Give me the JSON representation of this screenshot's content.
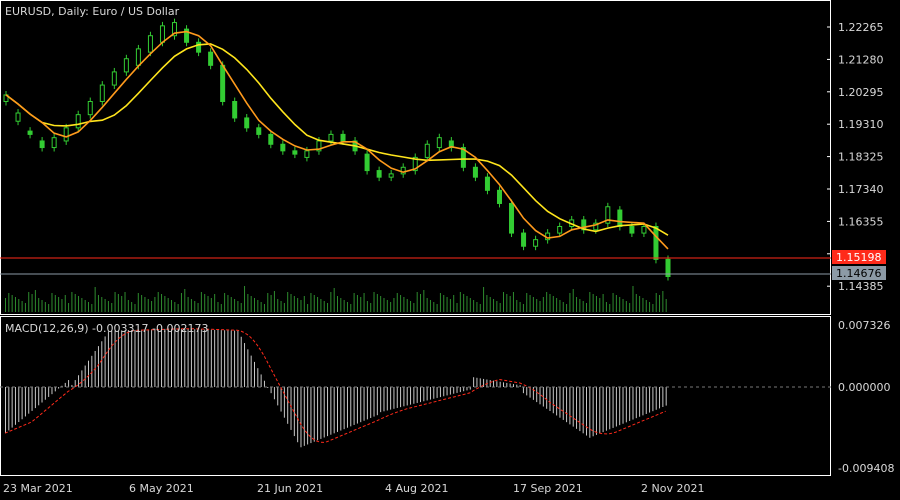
{
  "window": {
    "symbol_label": "EURUSD, Daily:  Euro / US Dollar",
    "background": "#000000",
    "grid_color": "#ffffff"
  },
  "price_axis": {
    "ticks": [
      "1.22265",
      "1.21280",
      "1.20295",
      "1.19310",
      "1.18325",
      "1.17340",
      "1.16355",
      "1.15370",
      "1.14385"
    ],
    "range": [
      1.1415,
      1.2285
    ]
  },
  "time_axis": {
    "ticks": [
      "23 Mar 2021",
      "6 May 2021",
      "21 Jun 2021",
      "4 Aug 2021",
      "17 Sep 2021",
      "2 Nov 2021"
    ]
  },
  "price_lines": {
    "alert": {
      "label": "1.15198",
      "color": "#ff2a1a"
    },
    "bid": {
      "label": "1.14676",
      "color": "#8c9aa6"
    }
  },
  "indicators": {
    "ma_fast_color": "#ff9a1c",
    "ma_slow_color": "#ffe51c",
    "candle_color": "#33cc33",
    "volume_color": "#2e8b2e"
  },
  "macd": {
    "label": "MACD(12,26,9) -0.003317 -0.002173",
    "ticks": [
      "0.007326",
      "0.000000",
      "-0.009408"
    ],
    "range": [
      -0.009408,
      0.007326
    ],
    "histogram_color": "#c8c8c8",
    "signal_color": "#ff2a1a"
  },
  "chart_data": {
    "type": "candlestick",
    "series": [
      {
        "name": "EURUSD",
        "values": [
          [
            1.2,
            1.202
          ],
          [
            1.194,
            1.1965
          ],
          [
            1.191,
            1.19
          ],
          [
            1.188,
            1.186
          ],
          [
            1.186,
            1.189
          ],
          [
            1.188,
            1.192
          ],
          [
            1.192,
            1.196
          ],
          [
            1.196,
            1.2
          ],
          [
            1.2,
            1.205
          ],
          [
            1.205,
            1.209
          ],
          [
            1.209,
            1.213
          ],
          [
            1.211,
            1.216
          ],
          [
            1.215,
            1.22
          ],
          [
            1.218,
            1.223
          ],
          [
            1.22,
            1.224
          ],
          [
            1.222,
            1.218
          ],
          [
            1.218,
            1.215
          ],
          [
            1.215,
            1.211
          ],
          [
            1.211,
            1.2
          ],
          [
            1.2,
            1.195
          ],
          [
            1.195,
            1.192
          ],
          [
            1.192,
            1.19
          ],
          [
            1.19,
            1.187
          ],
          [
            1.187,
            1.185
          ],
          [
            1.185,
            1.184
          ],
          [
            1.183,
            1.185
          ],
          [
            1.185,
            1.188
          ],
          [
            1.188,
            1.19
          ],
          [
            1.19,
            1.188
          ],
          [
            1.188,
            1.185
          ],
          [
            1.184,
            1.179
          ],
          [
            1.179,
            1.177
          ],
          [
            1.177,
            1.178
          ],
          [
            1.178,
            1.18
          ],
          [
            1.179,
            1.183
          ],
          [
            1.183,
            1.187
          ],
          [
            1.186,
            1.189
          ],
          [
            1.188,
            1.186
          ],
          [
            1.186,
            1.18
          ],
          [
            1.18,
            1.177
          ],
          [
            1.177,
            1.173
          ],
          [
            1.173,
            1.169
          ],
          [
            1.169,
            1.16
          ],
          [
            1.16,
            1.156
          ],
          [
            1.156,
            1.158
          ],
          [
            1.158,
            1.16
          ],
          [
            1.16,
            1.162
          ],
          [
            1.162,
            1.164
          ],
          [
            1.164,
            1.161
          ],
          [
            1.161,
            1.163
          ],
          [
            1.163,
            1.168
          ],
          [
            1.167,
            1.162
          ],
          [
            1.162,
            1.16
          ],
          [
            1.16,
            1.162
          ],
          [
            1.162,
            1.152
          ],
          [
            1.152,
            1.1468
          ]
        ]
      }
    ],
    "xlabel": "",
    "ylabel": ""
  }
}
